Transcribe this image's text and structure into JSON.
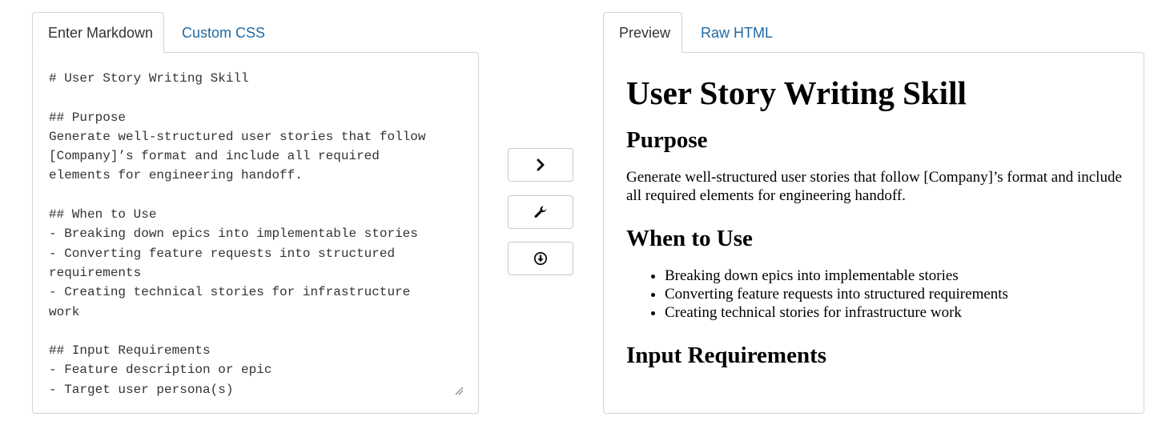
{
  "editor": {
    "tabs": [
      {
        "label": "Enter Markdown",
        "active": true
      },
      {
        "label": "Custom CSS",
        "active": false
      }
    ],
    "markdown": "# User Story Writing Skill\n\n## Purpose\nGenerate well-structured user stories that follow\n[Company]’s format and include all required\nelements for engineering handoff.\n\n## When to Use\n- Breaking down epics into implementable stories\n- Converting feature requests into structured\nrequirements\n- Creating technical stories for infrastructure\nwork\n\n## Input Requirements\n- Feature description or epic\n- Target user persona(s)"
  },
  "actions": [
    {
      "name": "convert",
      "icon": "chevron-right-icon"
    },
    {
      "name": "tools",
      "icon": "wrench-icon"
    },
    {
      "name": "download",
      "icon": "download-icon"
    }
  ],
  "output": {
    "tabs": [
      {
        "label": "Preview",
        "active": true
      },
      {
        "label": "Raw HTML",
        "active": false
      }
    ],
    "preview": {
      "h1": "User Story Writing Skill",
      "purpose_heading": "Purpose",
      "purpose_text": "Generate well-structured user stories that follow [Company]’s format and include all required elements for engineering handoff.",
      "when_heading": "When to Use",
      "when_items": [
        "Breaking down epics into implementable stories",
        "Converting feature requests into structured requirements",
        "Creating technical stories for infrastructure work"
      ],
      "input_heading": "Input Requirements"
    }
  },
  "colors": {
    "link": "#1f6aa5",
    "border": "#d4d4d4",
    "text": "#333333"
  }
}
